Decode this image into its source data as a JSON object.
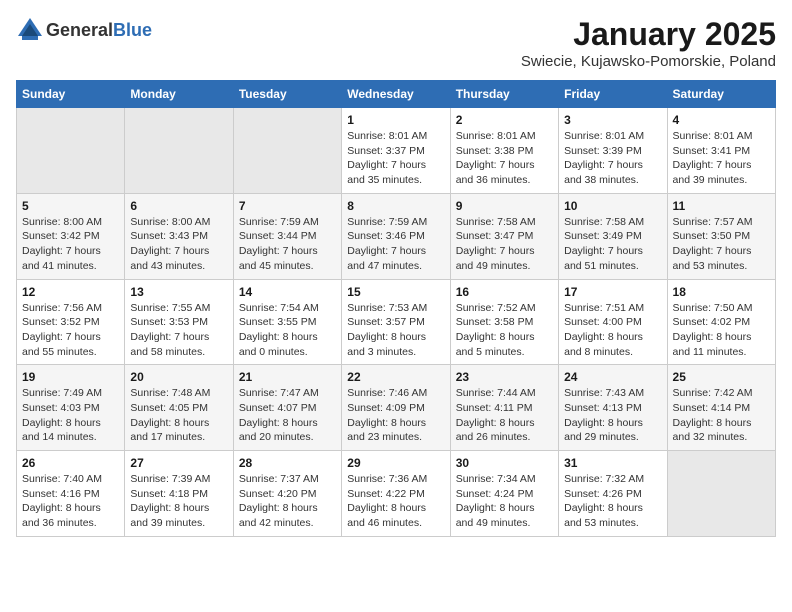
{
  "header": {
    "logo": {
      "general": "General",
      "blue": "Blue"
    },
    "title": "January 2025",
    "subtitle": "Swiecie, Kujawsko-Pomorskie, Poland"
  },
  "days_of_week": [
    "Sunday",
    "Monday",
    "Tuesday",
    "Wednesday",
    "Thursday",
    "Friday",
    "Saturday"
  ],
  "weeks": [
    {
      "cells": [
        {
          "empty": true
        },
        {
          "empty": true
        },
        {
          "empty": true
        },
        {
          "day": 1,
          "sunrise": "8:01 AM",
          "sunset": "3:37 PM",
          "daylight": "7 hours and 35 minutes."
        },
        {
          "day": 2,
          "sunrise": "8:01 AM",
          "sunset": "3:38 PM",
          "daylight": "7 hours and 36 minutes."
        },
        {
          "day": 3,
          "sunrise": "8:01 AM",
          "sunset": "3:39 PM",
          "daylight": "7 hours and 38 minutes."
        },
        {
          "day": 4,
          "sunrise": "8:01 AM",
          "sunset": "3:41 PM",
          "daylight": "7 hours and 39 minutes."
        }
      ]
    },
    {
      "cells": [
        {
          "day": 5,
          "sunrise": "8:00 AM",
          "sunset": "3:42 PM",
          "daylight": "7 hours and 41 minutes."
        },
        {
          "day": 6,
          "sunrise": "8:00 AM",
          "sunset": "3:43 PM",
          "daylight": "7 hours and 43 minutes."
        },
        {
          "day": 7,
          "sunrise": "7:59 AM",
          "sunset": "3:44 PM",
          "daylight": "7 hours and 45 minutes."
        },
        {
          "day": 8,
          "sunrise": "7:59 AM",
          "sunset": "3:46 PM",
          "daylight": "7 hours and 47 minutes."
        },
        {
          "day": 9,
          "sunrise": "7:58 AM",
          "sunset": "3:47 PM",
          "daylight": "7 hours and 49 minutes."
        },
        {
          "day": 10,
          "sunrise": "7:58 AM",
          "sunset": "3:49 PM",
          "daylight": "7 hours and 51 minutes."
        },
        {
          "day": 11,
          "sunrise": "7:57 AM",
          "sunset": "3:50 PM",
          "daylight": "7 hours and 53 minutes."
        }
      ]
    },
    {
      "cells": [
        {
          "day": 12,
          "sunrise": "7:56 AM",
          "sunset": "3:52 PM",
          "daylight": "7 hours and 55 minutes."
        },
        {
          "day": 13,
          "sunrise": "7:55 AM",
          "sunset": "3:53 PM",
          "daylight": "7 hours and 58 minutes."
        },
        {
          "day": 14,
          "sunrise": "7:54 AM",
          "sunset": "3:55 PM",
          "daylight": "8 hours and 0 minutes."
        },
        {
          "day": 15,
          "sunrise": "7:53 AM",
          "sunset": "3:57 PM",
          "daylight": "8 hours and 3 minutes."
        },
        {
          "day": 16,
          "sunrise": "7:52 AM",
          "sunset": "3:58 PM",
          "daylight": "8 hours and 5 minutes."
        },
        {
          "day": 17,
          "sunrise": "7:51 AM",
          "sunset": "4:00 PM",
          "daylight": "8 hours and 8 minutes."
        },
        {
          "day": 18,
          "sunrise": "7:50 AM",
          "sunset": "4:02 PM",
          "daylight": "8 hours and 11 minutes."
        }
      ]
    },
    {
      "cells": [
        {
          "day": 19,
          "sunrise": "7:49 AM",
          "sunset": "4:03 PM",
          "daylight": "8 hours and 14 minutes."
        },
        {
          "day": 20,
          "sunrise": "7:48 AM",
          "sunset": "4:05 PM",
          "daylight": "8 hours and 17 minutes."
        },
        {
          "day": 21,
          "sunrise": "7:47 AM",
          "sunset": "4:07 PM",
          "daylight": "8 hours and 20 minutes."
        },
        {
          "day": 22,
          "sunrise": "7:46 AM",
          "sunset": "4:09 PM",
          "daylight": "8 hours and 23 minutes."
        },
        {
          "day": 23,
          "sunrise": "7:44 AM",
          "sunset": "4:11 PM",
          "daylight": "8 hours and 26 minutes."
        },
        {
          "day": 24,
          "sunrise": "7:43 AM",
          "sunset": "4:13 PM",
          "daylight": "8 hours and 29 minutes."
        },
        {
          "day": 25,
          "sunrise": "7:42 AM",
          "sunset": "4:14 PM",
          "daylight": "8 hours and 32 minutes."
        }
      ]
    },
    {
      "cells": [
        {
          "day": 26,
          "sunrise": "7:40 AM",
          "sunset": "4:16 PM",
          "daylight": "8 hours and 36 minutes."
        },
        {
          "day": 27,
          "sunrise": "7:39 AM",
          "sunset": "4:18 PM",
          "daylight": "8 hours and 39 minutes."
        },
        {
          "day": 28,
          "sunrise": "7:37 AM",
          "sunset": "4:20 PM",
          "daylight": "8 hours and 42 minutes."
        },
        {
          "day": 29,
          "sunrise": "7:36 AM",
          "sunset": "4:22 PM",
          "daylight": "8 hours and 46 minutes."
        },
        {
          "day": 30,
          "sunrise": "7:34 AM",
          "sunset": "4:24 PM",
          "daylight": "8 hours and 49 minutes."
        },
        {
          "day": 31,
          "sunrise": "7:32 AM",
          "sunset": "4:26 PM",
          "daylight": "8 hours and 53 minutes."
        },
        {
          "empty": true
        }
      ]
    }
  ]
}
